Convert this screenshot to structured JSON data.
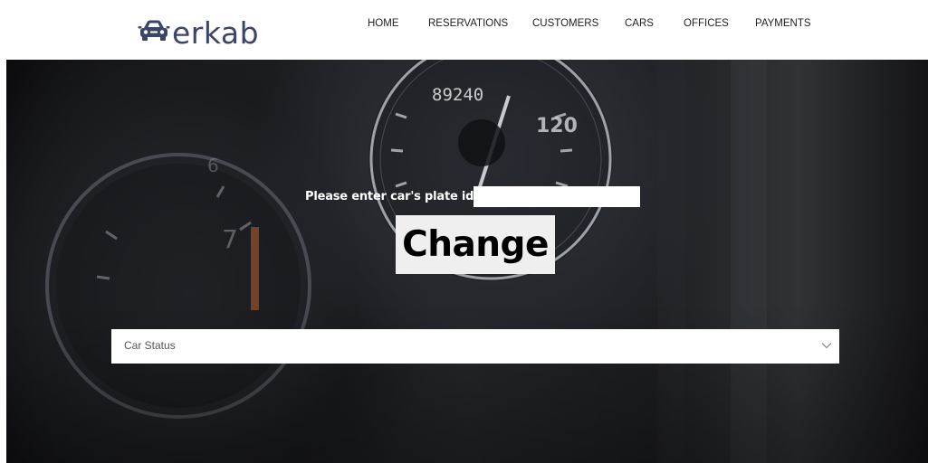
{
  "brand": {
    "name": "erkab",
    "icon": "car-icon",
    "color": "#3b4566"
  },
  "nav": {
    "items": [
      {
        "label": "HOME"
      },
      {
        "label": "RESERVATIONS"
      },
      {
        "label": "CUSTOMERS"
      },
      {
        "label": "CARS"
      },
      {
        "label": "OFFICES"
      },
      {
        "label": "PAYMENTS"
      }
    ]
  },
  "hero": {
    "background": "car dashboard speedometer photo (dark)",
    "gauge_odometer": "89240",
    "gauge_speed_label": "120"
  },
  "form": {
    "plate_label": "Please enter car's plate id",
    "plate_value": "",
    "change_button": "Change",
    "status_select": {
      "selected": "Car Status",
      "icon": "chevron-down-icon"
    }
  }
}
